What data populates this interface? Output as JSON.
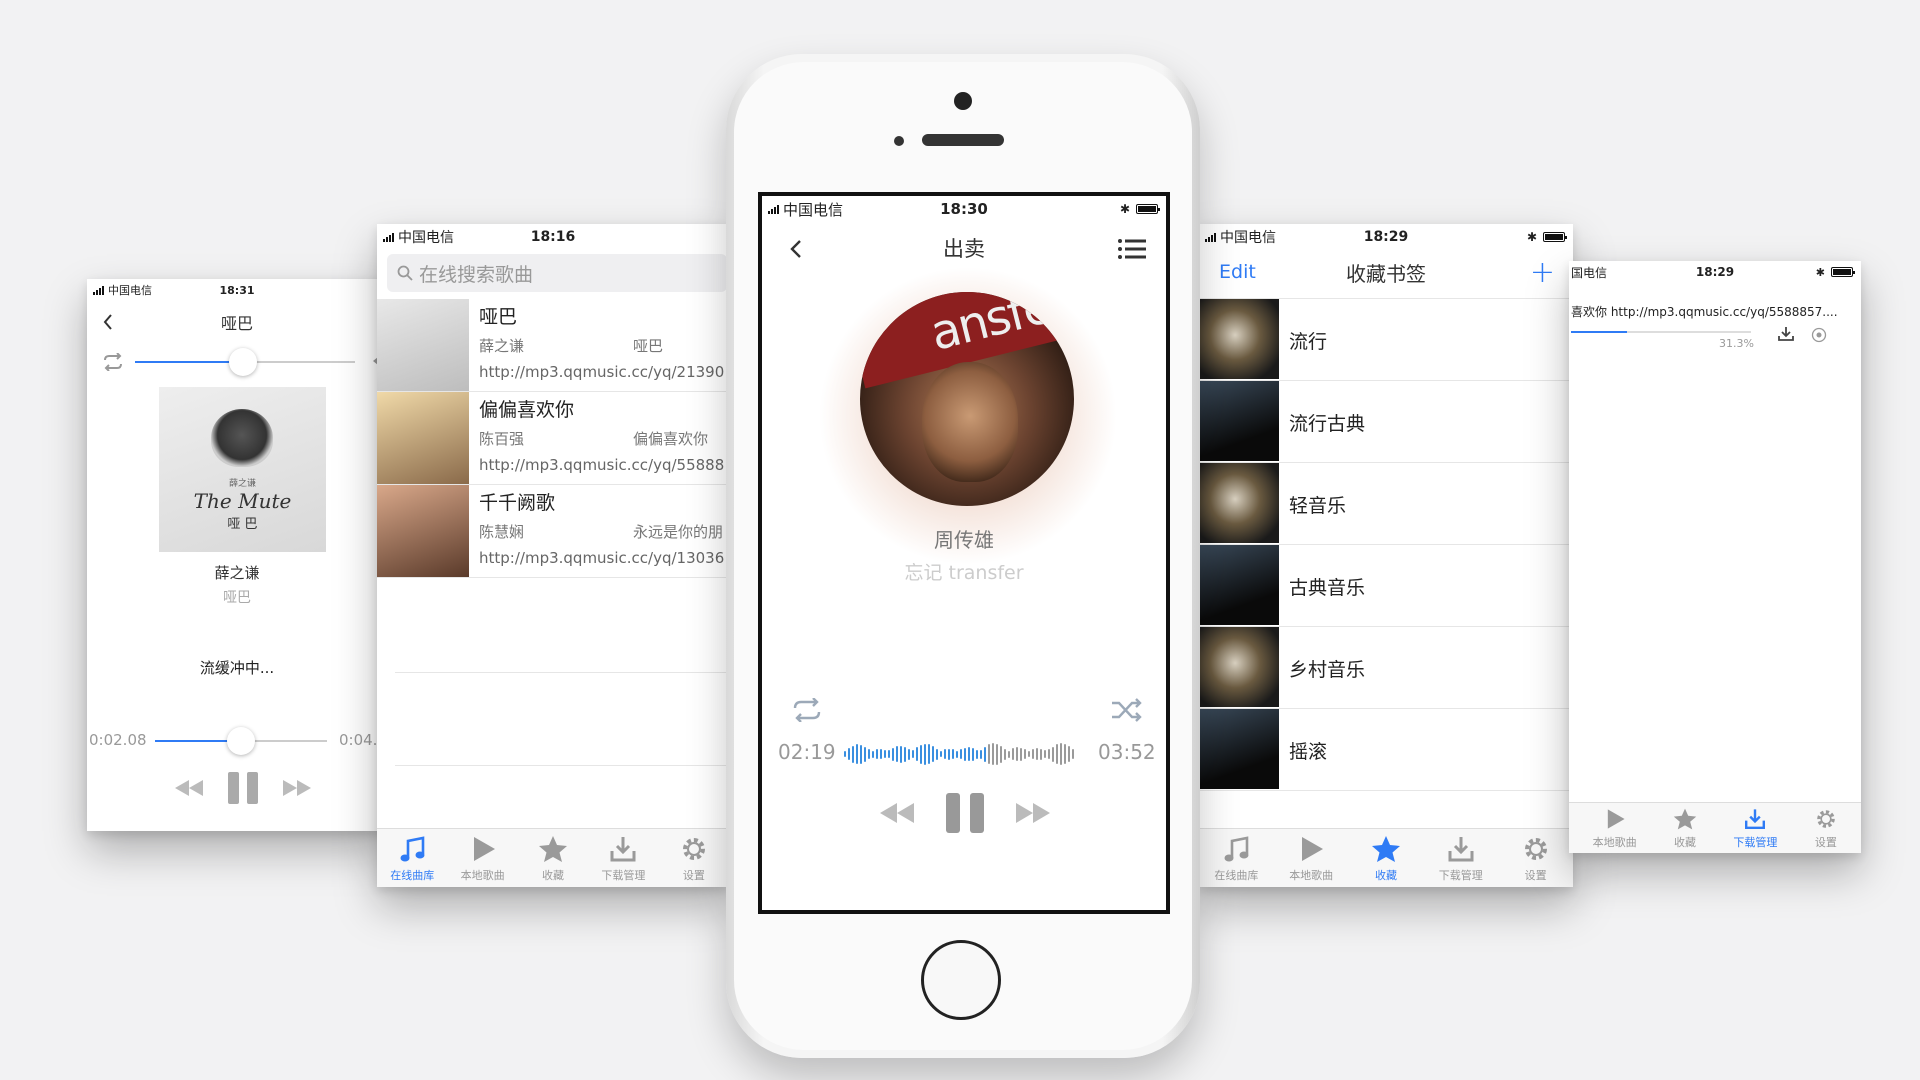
{
  "colors": {
    "accent": "#2f7bf5",
    "wave_played": "#3a8fe0",
    "wave_rest": "#9a9a9a"
  },
  "tabs": [
    {
      "label": "在线曲库",
      "icon": "music-note-icon"
    },
    {
      "label": "本地歌曲",
      "icon": "play-icon"
    },
    {
      "label": "收藏",
      "icon": "star-icon"
    },
    {
      "label": "下载管理",
      "icon": "download-icon"
    },
    {
      "label": "设置",
      "icon": "gear-icon"
    }
  ],
  "screen1": {
    "status": {
      "carrier": "中国电信",
      "time": "18:31"
    },
    "title": "哑巴",
    "artist": "薛之谦",
    "album": "哑巴",
    "buffering": "流缓冲中...",
    "elapsed": "0:02.08",
    "total": "0:04.",
    "volume_fraction": 0.49,
    "progress_fraction": 0.5,
    "album_art": {
      "small": "薛之谦",
      "title": "The Mute",
      "subtitle": "哑 巴"
    }
  },
  "screen2": {
    "status": {
      "carrier": "中国电信",
      "time": "18:16"
    },
    "search_placeholder": "在线搜索歌曲",
    "songs": [
      {
        "title": "哑巴",
        "artist": "薛之谦",
        "album": "哑巴",
        "url": "http://mp3.qqmusic.cc/yq/21390"
      },
      {
        "title": "偏偏喜欢你",
        "artist": "陈百强",
        "album": "偏偏喜欢你",
        "url": "http://mp3.qqmusic.cc/yq/55888"
      },
      {
        "title": "千千阙歌",
        "artist": "陈慧娴",
        "album": "永远是你的朋",
        "url": "http://mp3.qqmusic.cc/yq/13036"
      }
    ],
    "active_tab": 0
  },
  "screen3": {
    "status": {
      "carrier": "中国电信",
      "time": "18:30"
    },
    "title": "出卖",
    "artist": "周传雄",
    "album": "忘记 transfer",
    "album_art_text": "ansfe",
    "elapsed": "02:19",
    "total": "03:52",
    "progress_fraction": 0.62
  },
  "screen4": {
    "status": {
      "carrier": "中国电信",
      "time": "18:29"
    },
    "edit": "Edit",
    "title": "收藏书签",
    "add": "+",
    "items": [
      "流行",
      "流行古典",
      "轻音乐",
      "古典音乐",
      "乡村音乐",
      "摇滚"
    ],
    "active_tab": 2
  },
  "screen5": {
    "status": {
      "carrier": "国电信",
      "time": "18:29"
    },
    "download_text": "喜欢你 http://mp3.qqmusic.cc/yq/5588857....",
    "percent": "31.3%",
    "progress_fraction": 0.313,
    "active_tab": 3
  }
}
